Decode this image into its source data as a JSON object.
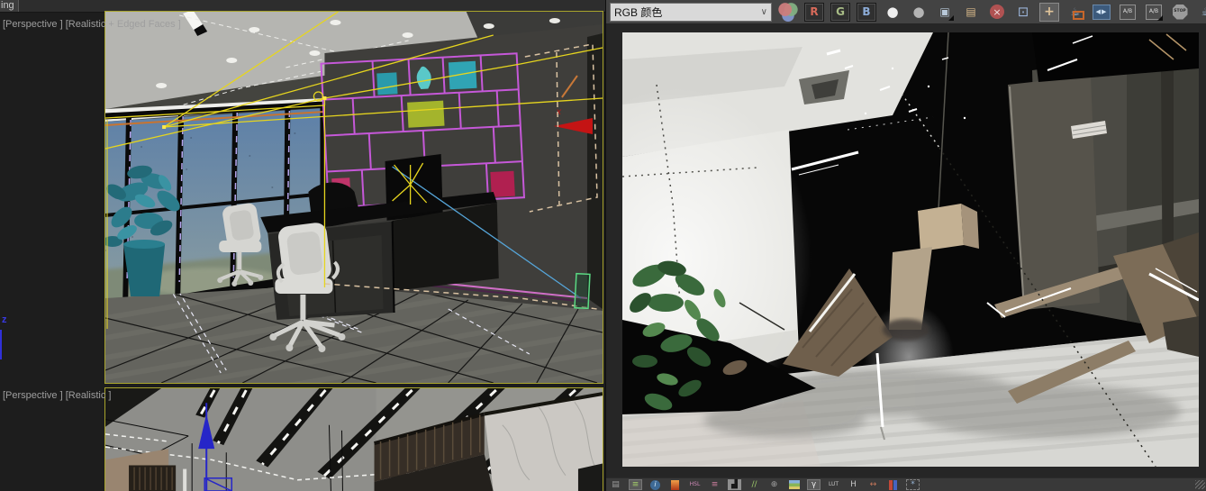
{
  "window": {
    "menu_fragment": "ing"
  },
  "viewports": {
    "top_label": "[Perspective ] [Realistic + Edged Faces ]",
    "bottom_label": "[Perspective ] [Realistic ]",
    "axis_label": "z"
  },
  "vfb": {
    "channel_dropdown": {
      "value": "RGB 颜色",
      "chevron": "∨"
    },
    "top_toolbar": [
      {
        "name": "rgb-circles-icon",
        "glyph": ""
      },
      {
        "name": "red-channel-button",
        "glyph": "R",
        "color": "#d86a5a",
        "framed": true
      },
      {
        "name": "green-channel-button",
        "glyph": "G",
        "color": "#a8bc86",
        "framed": true
      },
      {
        "name": "blue-channel-button",
        "glyph": "B",
        "color": "#8cacd8",
        "framed": true
      },
      {
        "name": "alpha-channel-icon",
        "glyph": "●",
        "color": "#efefef",
        "big": true
      },
      {
        "name": "monochrome-icon",
        "glyph": "●",
        "color": "#b4b4b4",
        "big": true
      },
      {
        "name": "save-image-icon",
        "glyph": "▣",
        "color": "#b9c9d9",
        "corner": true
      },
      {
        "name": "open-image-icon",
        "glyph": "▤",
        "color": "#d9b98a"
      },
      {
        "name": "clear-image-icon",
        "glyph": "×"
      },
      {
        "name": "duplicate-to-host-icon",
        "glyph": "⊡",
        "color": "#9ab2d6",
        "big": true
      },
      {
        "name": "track-mouse-icon",
        "glyph": "+",
        "color": "#e0c49a",
        "pressed": true,
        "bold": true
      },
      {
        "name": "render-last-icon",
        "glyph": "☕",
        "color": "#9cb8d4"
      },
      {
        "name": "ab-split-icon",
        "glyph": "◀▶"
      },
      {
        "name": "ab-compare-horizontal-icon",
        "glyph": "A/B"
      },
      {
        "name": "ab-compare-vertical-icon",
        "glyph": "A/B",
        "corner": true
      },
      {
        "name": "stop-render-icon",
        "glyph": "STOP"
      },
      {
        "name": "render-teapot-icon",
        "glyph": "☕",
        "color": "#9cb8d4"
      }
    ],
    "bottom_toolbar": [
      {
        "name": "show-corrections-panel-icon",
        "glyph": "▤",
        "color": "#9a9a9a"
      },
      {
        "name": "layers-icon",
        "glyph": "≡",
        "color": "#a6d06a",
        "pressed": true
      },
      {
        "name": "pixel-info-icon",
        "glyph": "i"
      },
      {
        "name": "exposure-icon",
        "glyph": ""
      },
      {
        "name": "hsl-icon",
        "glyph": "HSL",
        "color": "#d08ab8",
        "small": true
      },
      {
        "name": "color-balance-icon",
        "glyph": "≡",
        "color": "#cf7fa0"
      },
      {
        "name": "levels-icon",
        "glyph": "▟",
        "color": "#181818"
      },
      {
        "name": "white-balance-icon",
        "glyph": "//",
        "color": "#9cc868"
      },
      {
        "name": "navigation-icon",
        "glyph": "⊕",
        "color": "#a0a0a0"
      },
      {
        "name": "background-image-icon",
        "glyph": ""
      },
      {
        "name": "display-correction-icon",
        "glyph": "γ",
        "color": "#e8e8e8",
        "pressed": true
      },
      {
        "name": "lut-icon",
        "glyph": "LUT",
        "color": "#c4c4c4",
        "small": true
      },
      {
        "name": "histogram-icon",
        "glyph": "H",
        "color": "#c4c4c4"
      },
      {
        "name": "compare-wipe-icon",
        "glyph": "↔",
        "color": "#c8785a"
      },
      {
        "name": "color-clamp-icon",
        "glyph": ""
      },
      {
        "name": "freeze-icon",
        "glyph": "*",
        "color": "#9ab8d8",
        "dashed": true
      }
    ]
  },
  "colors": {
    "safe_frame_border": "#a8a42c",
    "viewport_label": "#9e9e9e",
    "selection_wireframe": "#e6d51e",
    "shelf_wireframe": "#c558d8",
    "toolbar_bg": "#434343",
    "canvas_bg": "#262626",
    "gizmo_z_blue": "#3030d8",
    "gizmo_x_red": "#c41414"
  }
}
